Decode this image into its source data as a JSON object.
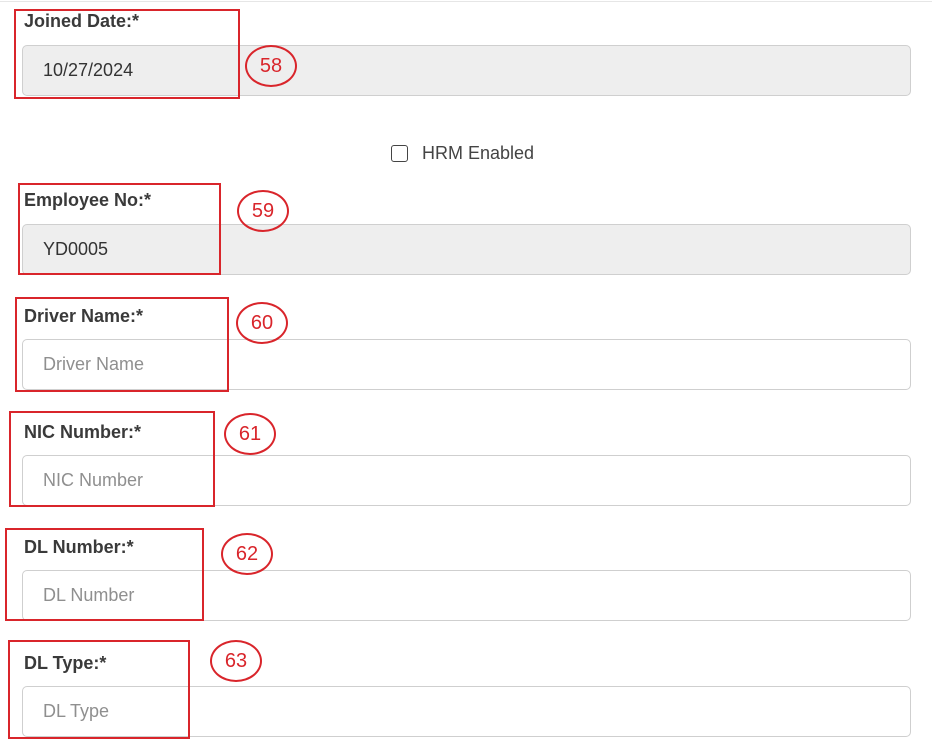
{
  "form": {
    "joined_date": {
      "label": "Joined Date:*",
      "value": "10/27/2024",
      "annotation": "58"
    },
    "hrm_enabled": {
      "label": "HRM Enabled",
      "checked": false
    },
    "employee_no": {
      "label": "Employee No:*",
      "value": "YD0005",
      "annotation": "59"
    },
    "driver_name": {
      "label": "Driver Name:*",
      "placeholder": "Driver Name",
      "annotation": "60"
    },
    "nic_number": {
      "label": "NIC Number:*",
      "placeholder": "NIC Number",
      "annotation": "61"
    },
    "dl_number": {
      "label": "DL Number:*",
      "placeholder": "DL Number",
      "annotation": "62"
    },
    "dl_type": {
      "label": "DL Type:*",
      "placeholder": "DL Type",
      "annotation": "63"
    }
  },
  "colors": {
    "annotation": "#d9252b",
    "readonly_bg": "#eeeeee",
    "input_border": "#cfcfcf"
  }
}
